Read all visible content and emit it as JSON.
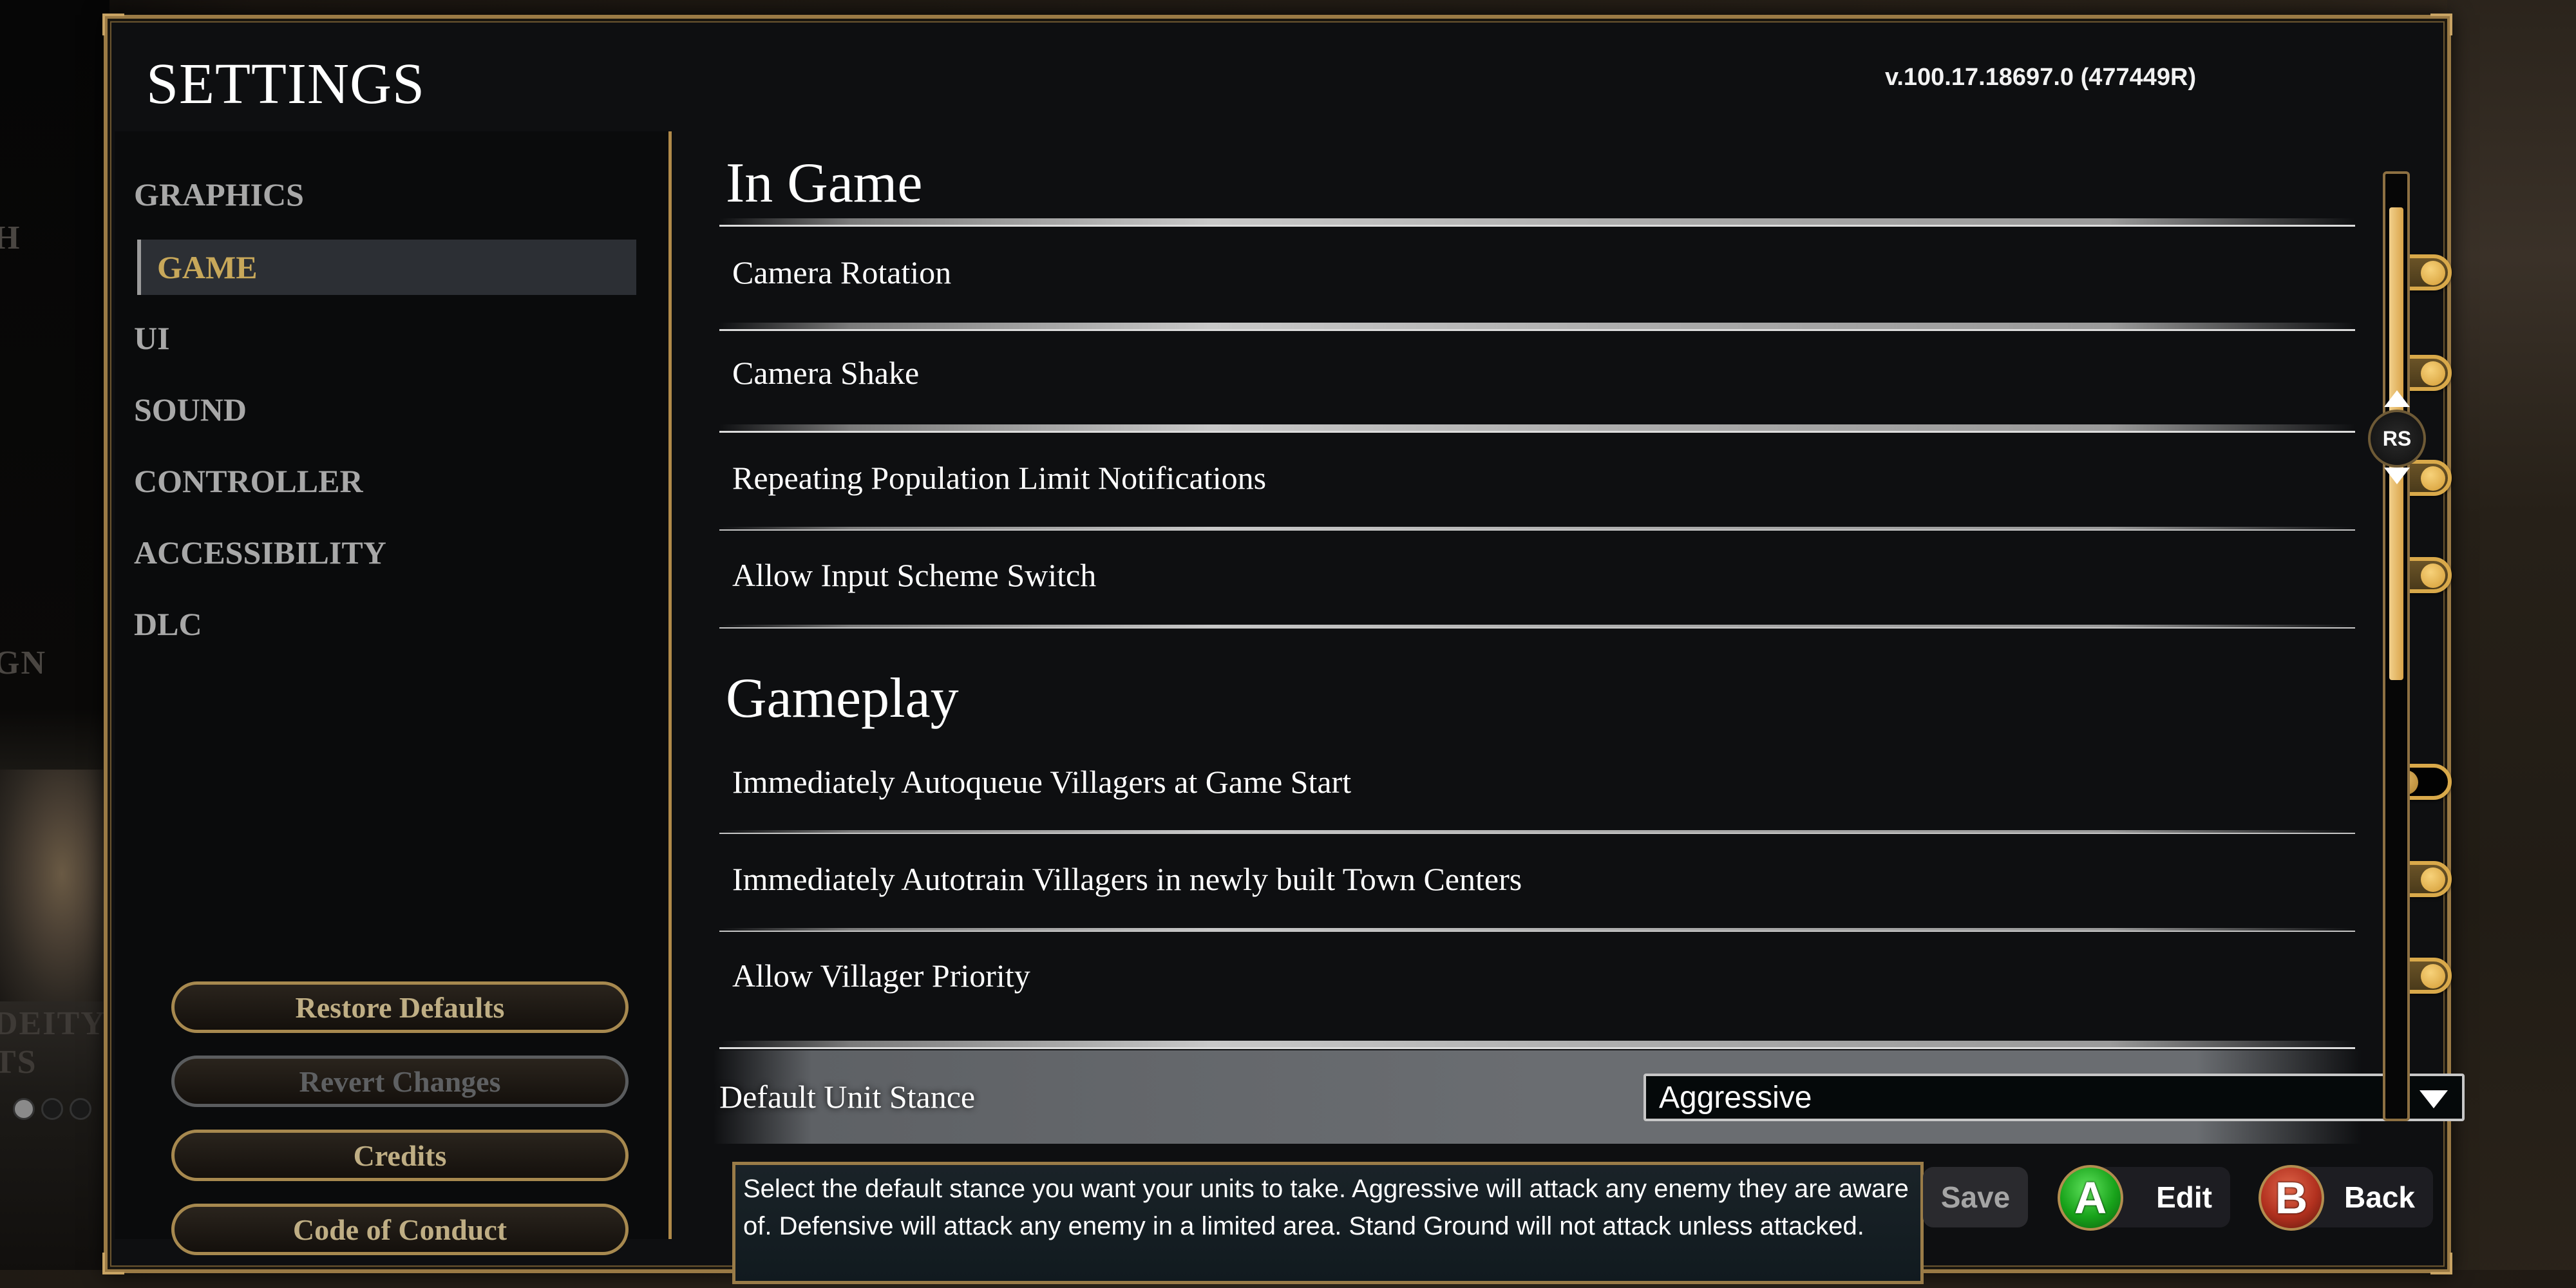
{
  "background": {
    "left_labels": [
      "H",
      "GN",
      "DEITY",
      "TS"
    ],
    "carousel_dots": [
      true,
      false,
      false
    ]
  },
  "header": {
    "title": "SETTINGS",
    "version": "v.100.17.18697.0 (477449R)"
  },
  "sidebar": {
    "items": [
      {
        "label": "GRAPHICS",
        "active": false
      },
      {
        "label": "GAME",
        "active": true
      },
      {
        "label": "UI",
        "active": false
      },
      {
        "label": "SOUND",
        "active": false
      },
      {
        "label": "CONTROLLER",
        "active": false
      },
      {
        "label": "ACCESSIBILITY",
        "active": false
      },
      {
        "label": "DLC",
        "active": false
      }
    ],
    "buttons": {
      "restore_defaults": "Restore Defaults",
      "revert_changes": "Revert Changes",
      "credits": "Credits",
      "code_of_conduct": "Code of Conduct"
    }
  },
  "sections": [
    {
      "heading": "In Game",
      "settings": [
        {
          "label": "Camera Rotation",
          "enabled": true
        },
        {
          "label": "Camera Shake",
          "enabled": true
        },
        {
          "label": "Repeating Population Limit Notifications",
          "enabled": true
        },
        {
          "label": "Allow Input Scheme Switch",
          "enabled": true
        }
      ]
    },
    {
      "heading": "Gameplay",
      "settings": [
        {
          "label": "Immediately Autoqueue Villagers at Game Start",
          "enabled": false
        },
        {
          "label": "Immediately Autotrain Villagers in newly built Town Centers",
          "enabled": true
        },
        {
          "label": "Allow Villager Priority",
          "enabled": true
        }
      ]
    }
  ],
  "stance": {
    "label": "Default Unit Stance",
    "selected": "Aggressive"
  },
  "scrollbar": {
    "handle_label": "RS",
    "thumb_start_fraction": 0.03,
    "thumb_size_fraction": 0.5
  },
  "tooltip": {
    "text": "Select the default stance you want your units to take. Aggressive will attack any enemy they are aware of. Defensive will attack any enemy in a limited area. Stand Ground will not attack unless attacked."
  },
  "footer": {
    "save_label": "Save",
    "edit_key": "A",
    "edit_label": "Edit",
    "back_key": "B",
    "back_label": "Back"
  },
  "colors": {
    "accent_gold": "#c8a85a",
    "toggle_gold": "#d9a94a",
    "a_button": "#18a21a",
    "b_button": "#b2311f"
  }
}
